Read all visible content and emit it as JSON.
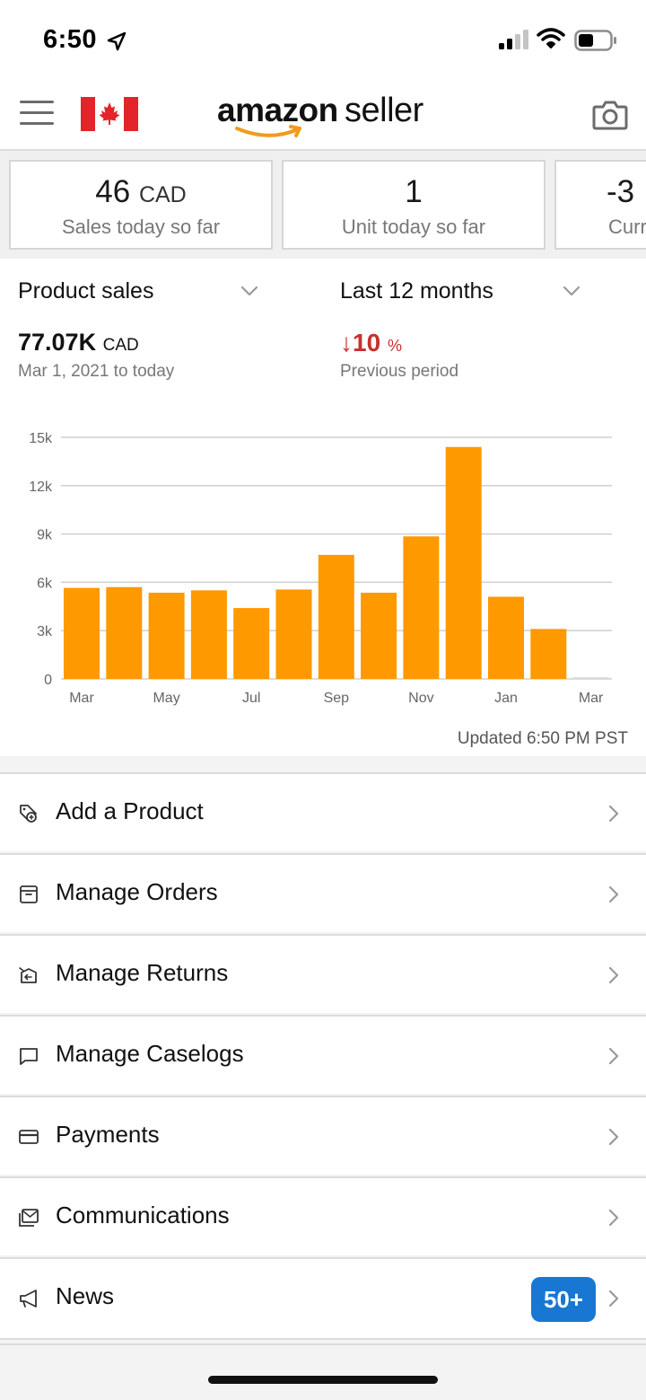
{
  "status_bar": {
    "time": "6:50"
  },
  "header": {
    "logo_amazon": "amazon",
    "logo_seller": "seller"
  },
  "cards": [
    {
      "value": "46",
      "unit": "CAD",
      "label": "Sales today so far"
    },
    {
      "value": "1",
      "unit": "",
      "label": "Unit today so far"
    },
    {
      "value": "-3",
      "unit": "",
      "label": "Curr"
    }
  ],
  "sales": {
    "metric_dropdown": "Product sales",
    "period_dropdown": "Last 12 months",
    "total_value": "77.07K",
    "total_unit": "CAD",
    "date_range": "Mar 1, 2021 to today",
    "change_arrow": "↓",
    "change_value": "10",
    "change_unit": "%",
    "change_label": "Previous period",
    "updated": "Updated 6:50 PM PST"
  },
  "chart_data": {
    "type": "bar",
    "categories": [
      "Mar",
      "Apr",
      "May",
      "Jun",
      "Jul",
      "Aug",
      "Sep",
      "Oct",
      "Nov",
      "Dec",
      "Jan",
      "Feb",
      "Mar"
    ],
    "x_tick_labels": [
      "Mar",
      "May",
      "Jul",
      "Sep",
      "Nov",
      "Jan",
      "Mar"
    ],
    "x_tick_indices": [
      0,
      2,
      4,
      6,
      8,
      10,
      12
    ],
    "values": [
      5650,
      5700,
      5350,
      5500,
      4400,
      5550,
      7700,
      5350,
      8850,
      14400,
      5100,
      3100,
      100
    ],
    "y_ticks": [
      0,
      3000,
      6000,
      9000,
      12000,
      15000
    ],
    "y_tick_labels": [
      "0",
      "3k",
      "6k",
      "9k",
      "12k",
      "15k"
    ],
    "ylim": [
      0,
      15000
    ],
    "bar_color": "#ff9900",
    "grid": true
  },
  "menu": {
    "items": [
      {
        "label": "Add a Product",
        "icon": "tag-plus-icon"
      },
      {
        "label": "Manage Orders",
        "icon": "box-icon"
      },
      {
        "label": "Manage Returns",
        "icon": "return-box-icon"
      },
      {
        "label": "Manage Caselogs",
        "icon": "chat-icon"
      },
      {
        "label": "Payments",
        "icon": "card-icon"
      },
      {
        "label": "Communications",
        "icon": "mail-icon"
      },
      {
        "label": "News",
        "icon": "megaphone-icon",
        "badge": "50+"
      }
    ]
  },
  "colors": {
    "accent": "#ff9900",
    "negative": "#c8302c",
    "badge": "#1877d2"
  }
}
